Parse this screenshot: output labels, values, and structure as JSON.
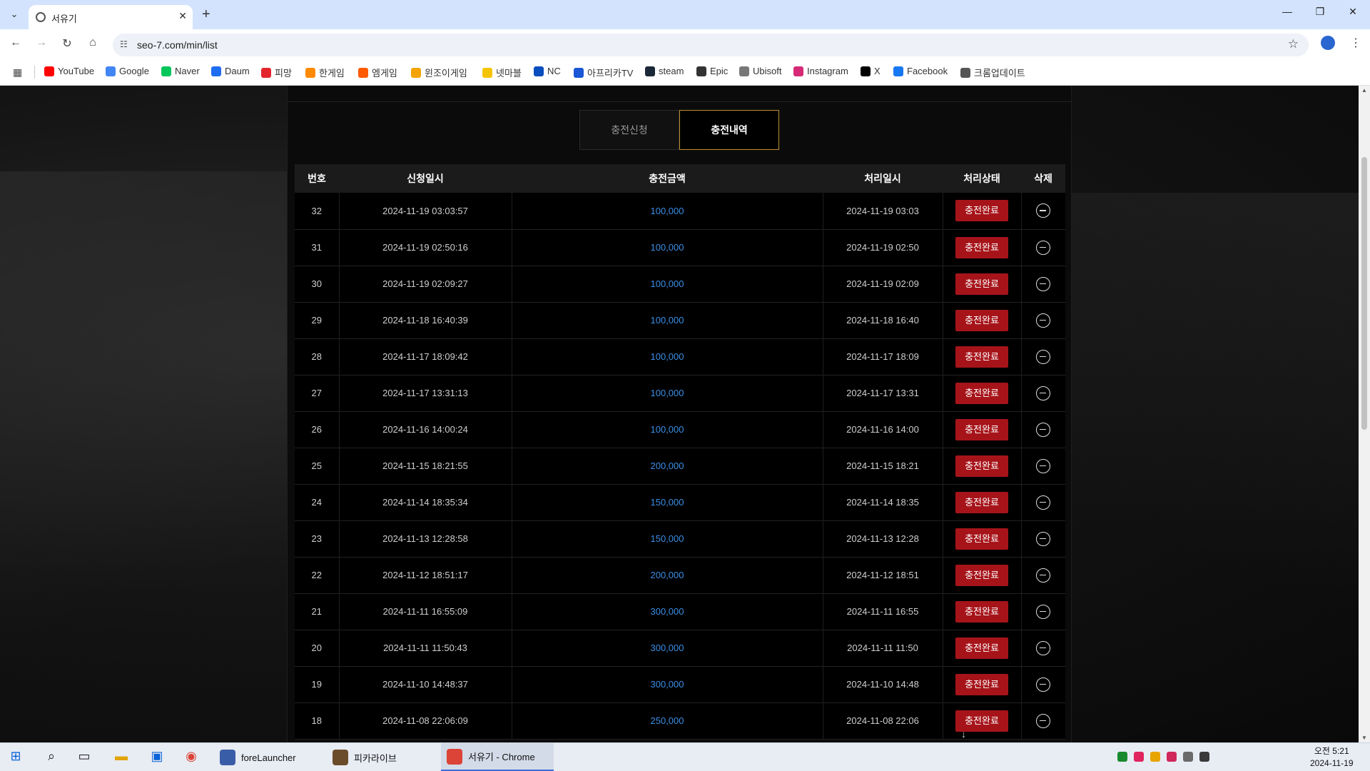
{
  "browser": {
    "tab_title": "서유기",
    "url": "seo-7.com/min/list"
  },
  "bookmarks": [
    {
      "label": "YouTube",
      "color": "#ff0000"
    },
    {
      "label": "Google",
      "color": "#4285f4"
    },
    {
      "label": "Naver",
      "color": "#03c75a"
    },
    {
      "label": "Daum",
      "color": "#1d6cf2"
    },
    {
      "label": "피망",
      "color": "#e3262b"
    },
    {
      "label": "한게임",
      "color": "#ff8a00"
    },
    {
      "label": "엠게임",
      "color": "#ff5a00"
    },
    {
      "label": "윈조이게임",
      "color": "#f5a300"
    },
    {
      "label": "넷마블",
      "color": "#f5c400"
    },
    {
      "label": "NC",
      "color": "#0a4dbf"
    },
    {
      "label": "아프리카TV",
      "color": "#1a56d6"
    },
    {
      "label": "steam",
      "color": "#1b2838"
    },
    {
      "label": "Epic",
      "color": "#333333"
    },
    {
      "label": "Ubisoft",
      "color": "#777777"
    },
    {
      "label": "Instagram",
      "color": "#d62976"
    },
    {
      "label": "X",
      "color": "#000000"
    },
    {
      "label": "Facebook",
      "color": "#1877f2"
    },
    {
      "label": "크롬업데이트",
      "color": "#555555"
    }
  ],
  "subtabs": {
    "apply": "충전신청",
    "history": "충전내역"
  },
  "table": {
    "headers": [
      "번호",
      "신청일시",
      "충전금액",
      "처리일시",
      "처리상태",
      "삭제"
    ],
    "rows": [
      {
        "no": "32",
        "requested": "2024-11-19 03:03:57",
        "amount": "100,000",
        "processed": "2024-11-19 03:03",
        "status": "충전완료"
      },
      {
        "no": "31",
        "requested": "2024-11-19 02:50:16",
        "amount": "100,000",
        "processed": "2024-11-19 02:50",
        "status": "충전완료"
      },
      {
        "no": "30",
        "requested": "2024-11-19 02:09:27",
        "amount": "100,000",
        "processed": "2024-11-19 02:09",
        "status": "충전완료"
      },
      {
        "no": "29",
        "requested": "2024-11-18 16:40:39",
        "amount": "100,000",
        "processed": "2024-11-18 16:40",
        "status": "충전완료"
      },
      {
        "no": "28",
        "requested": "2024-11-17 18:09:42",
        "amount": "100,000",
        "processed": "2024-11-17 18:09",
        "status": "충전완료"
      },
      {
        "no": "27",
        "requested": "2024-11-17 13:31:13",
        "amount": "100,000",
        "processed": "2024-11-17 13:31",
        "status": "충전완료"
      },
      {
        "no": "26",
        "requested": "2024-11-16 14:00:24",
        "amount": "100,000",
        "processed": "2024-11-16 14:00",
        "status": "충전완료"
      },
      {
        "no": "25",
        "requested": "2024-11-15 18:21:55",
        "amount": "200,000",
        "processed": "2024-11-15 18:21",
        "status": "충전완료"
      },
      {
        "no": "24",
        "requested": "2024-11-14 18:35:34",
        "amount": "150,000",
        "processed": "2024-11-14 18:35",
        "status": "충전완료"
      },
      {
        "no": "23",
        "requested": "2024-11-13 12:28:58",
        "amount": "150,000",
        "processed": "2024-11-13 12:28",
        "status": "충전완료"
      },
      {
        "no": "22",
        "requested": "2024-11-12 18:51:17",
        "amount": "200,000",
        "processed": "2024-11-12 18:51",
        "status": "충전완료"
      },
      {
        "no": "21",
        "requested": "2024-11-11 16:55:09",
        "amount": "300,000",
        "processed": "2024-11-11 16:55",
        "status": "충전완료"
      },
      {
        "no": "20",
        "requested": "2024-11-11 11:50:43",
        "amount": "300,000",
        "processed": "2024-11-11 11:50",
        "status": "충전완료"
      },
      {
        "no": "19",
        "requested": "2024-11-10 14:48:37",
        "amount": "300,000",
        "processed": "2024-11-10 14:48",
        "status": "충전완료"
      },
      {
        "no": "18",
        "requested": "2024-11-08 22:06:09",
        "amount": "250,000",
        "processed": "2024-11-08 22:06",
        "status": "충전완료"
      }
    ]
  },
  "taskbar": {
    "apps": [
      {
        "label": "foreLauncher",
        "color": "#3a5da8"
      },
      {
        "label": "피카라이브",
        "color": "#6b4c2a"
      },
      {
        "label": "서유기 - Chrome",
        "color": "#db4437"
      }
    ],
    "tray_colors": [
      "#1a8a2e",
      "#e0245e",
      "#e8a400",
      "#d0285a",
      "#6a6a6a",
      "#3a3a3a"
    ],
    "clock_time": "오전 5:21",
    "clock_date": "2024-11-19"
  },
  "colors": {
    "status_red": "#a6141a",
    "amount_blue": "#3b8ee6",
    "active_tab_border": "#b98f2e"
  }
}
